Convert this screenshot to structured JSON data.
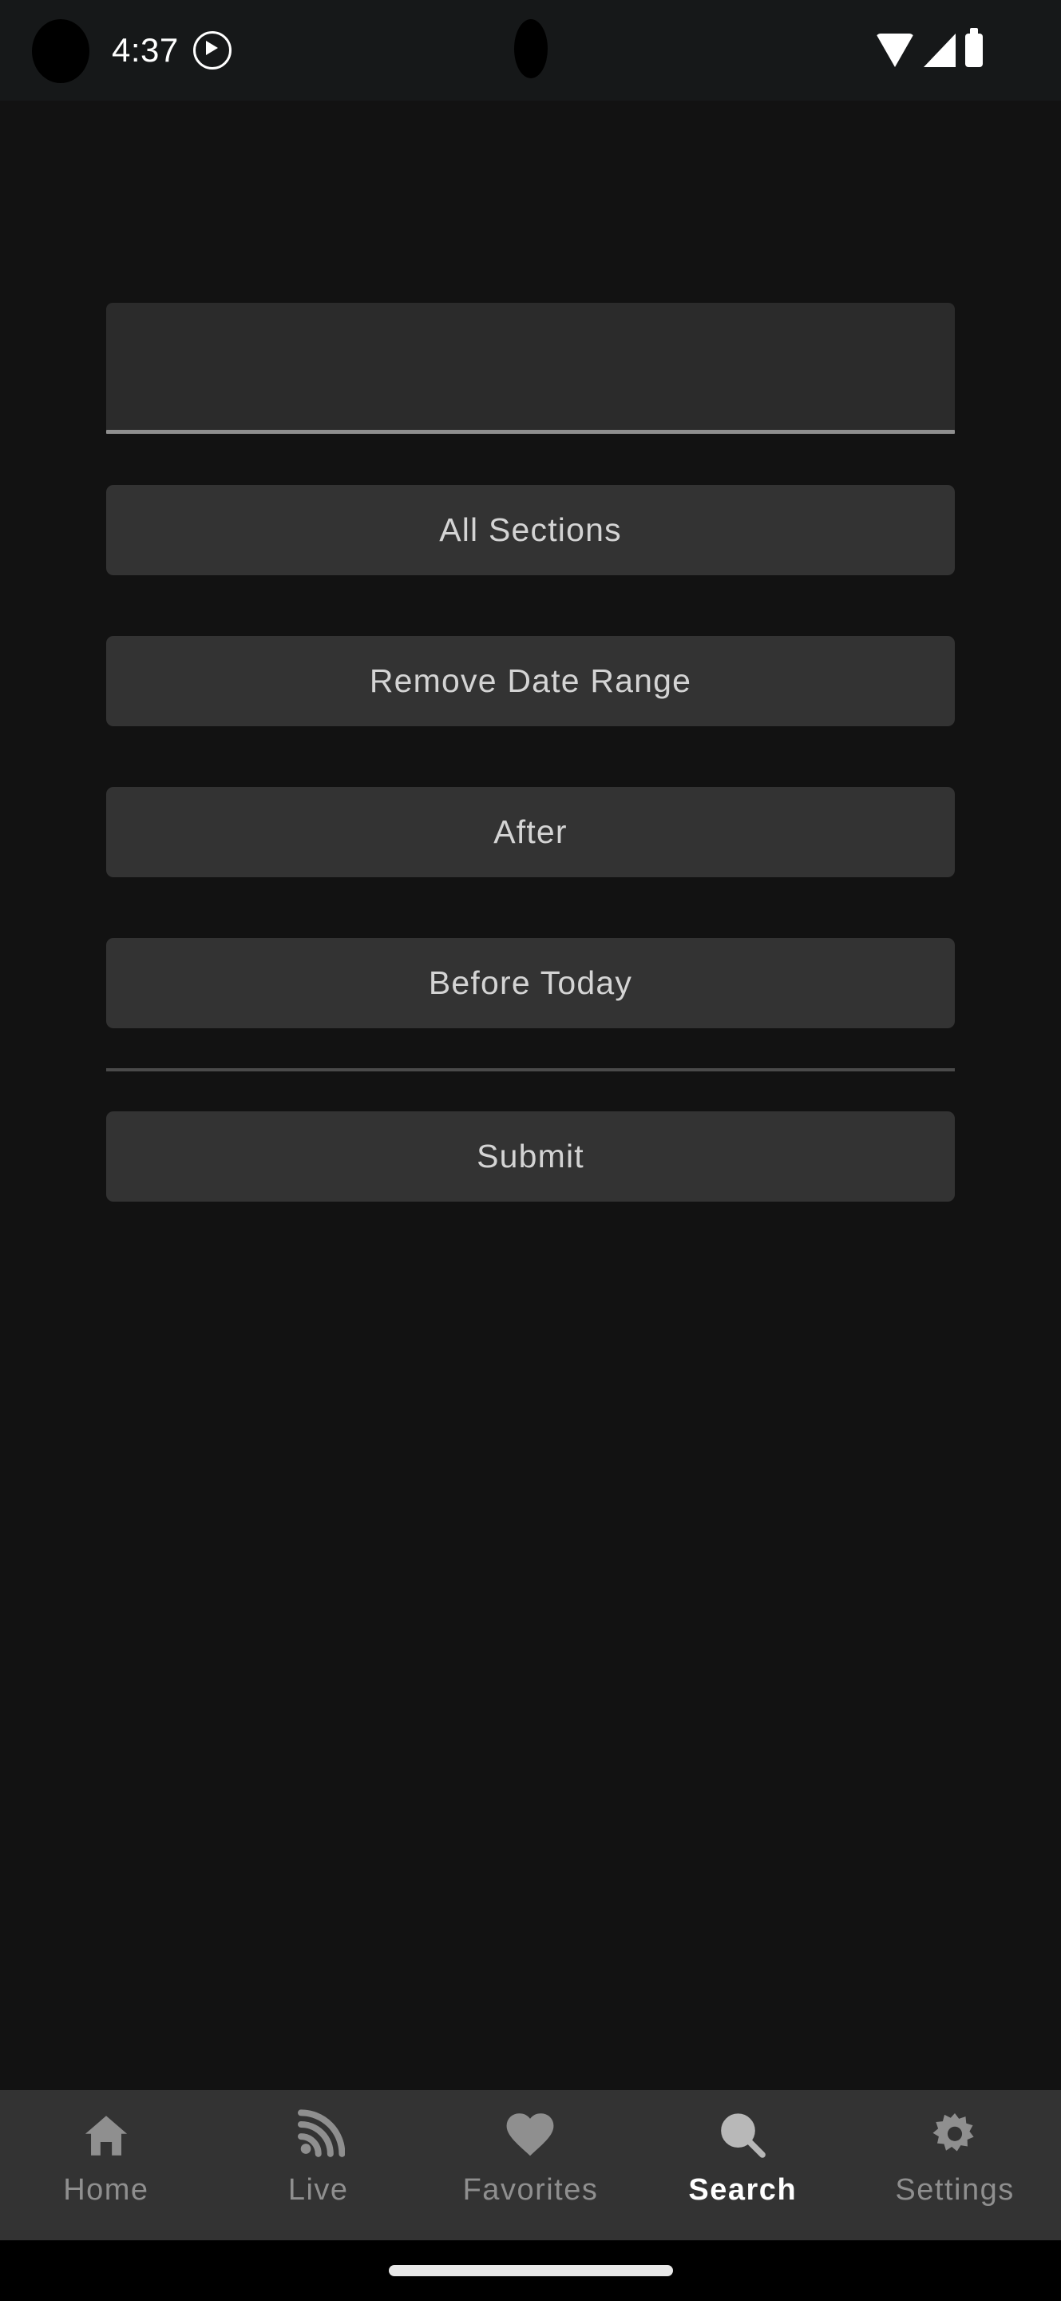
{
  "status_bar": {
    "time": "4:37",
    "play_icon": "play-circle-icon",
    "wifi_icon": "wifi-icon",
    "signal_icon": "cellular-signal-icon",
    "battery_icon": "battery-full-icon",
    "camera_cutout": "front-camera-cutout"
  },
  "screen": {
    "background_color": "#121212",
    "surface_color": "#333333",
    "field_color": "#2b2b2b",
    "text_color": "#d4d4d4",
    "active_color": "#ffffff",
    "inactive_color": "#8f8f8f"
  },
  "search_form": {
    "query_input": {
      "value": "",
      "placeholder": ""
    },
    "section_button": "All Sections",
    "remove_date_range_button": "Remove Date Range",
    "after_button": "After",
    "before_button": "Before Today",
    "submit_button": "Submit"
  },
  "bottom_nav": {
    "active_index": 3,
    "items": [
      {
        "label": "Home",
        "icon": "home-icon"
      },
      {
        "label": "Live",
        "icon": "broadcast-icon"
      },
      {
        "label": "Favorites",
        "icon": "heart-icon"
      },
      {
        "label": "Search",
        "icon": "search-icon"
      },
      {
        "label": "Settings",
        "icon": "gear-icon"
      }
    ]
  },
  "gesture_bar": {
    "handle": "home-gesture-pill"
  }
}
